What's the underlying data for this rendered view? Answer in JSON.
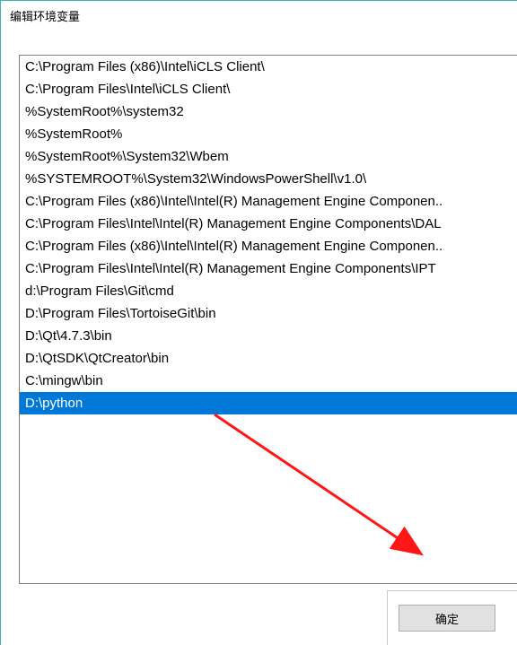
{
  "window": {
    "title": "编辑环境变量"
  },
  "list": {
    "items": [
      {
        "value": "C:\\Program Files (x86)\\Intel\\iCLS Client\\",
        "selected": false
      },
      {
        "value": "C:\\Program Files\\Intel\\iCLS Client\\",
        "selected": false
      },
      {
        "value": "%SystemRoot%\\system32",
        "selected": false
      },
      {
        "value": "%SystemRoot%",
        "selected": false
      },
      {
        "value": "%SystemRoot%\\System32\\Wbem",
        "selected": false
      },
      {
        "value": "%SYSTEMROOT%\\System32\\WindowsPowerShell\\v1.0\\",
        "selected": false
      },
      {
        "value": "C:\\Program Files (x86)\\Intel\\Intel(R) Management Engine Componen..",
        "selected": false
      },
      {
        "value": "C:\\Program Files\\Intel\\Intel(R) Management Engine Components\\DAL",
        "selected": false
      },
      {
        "value": "C:\\Program Files (x86)\\Intel\\Intel(R) Management Engine Componen..",
        "selected": false
      },
      {
        "value": "C:\\Program Files\\Intel\\Intel(R) Management Engine Components\\IPT",
        "selected": false
      },
      {
        "value": "d:\\Program Files\\Git\\cmd",
        "selected": false
      },
      {
        "value": "D:\\Program Files\\TortoiseGit\\bin",
        "selected": false
      },
      {
        "value": "D:\\Qt\\4.7.3\\bin",
        "selected": false
      },
      {
        "value": "D:\\QtSDK\\QtCreator\\bin",
        "selected": false
      },
      {
        "value": "C:\\mingw\\bin",
        "selected": false
      },
      {
        "value": "D:\\python",
        "selected": true
      }
    ]
  },
  "buttons": {
    "ok_label": "确定"
  },
  "annotation": {
    "arrow_color": "#ff1616"
  }
}
